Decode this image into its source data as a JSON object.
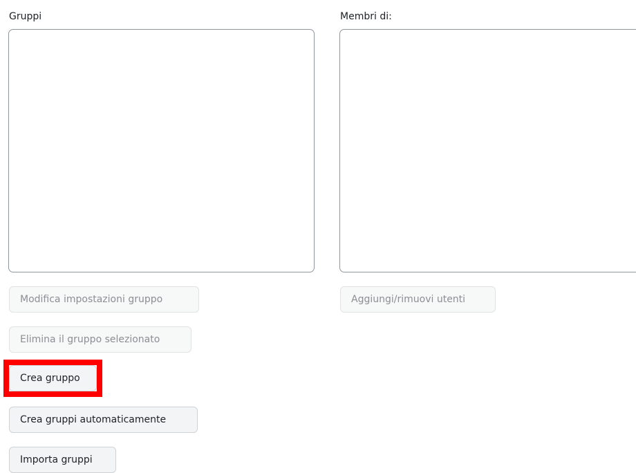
{
  "groups_panel": {
    "label": "Gruppi",
    "items": []
  },
  "members_panel": {
    "label": "Membri di:",
    "items": []
  },
  "buttons": {
    "edit_group_settings": "Modifica impostazioni gruppo",
    "delete_selected_group": "Elimina il gruppo selezionato",
    "create_group": "Crea gruppo",
    "auto_create_groups": "Crea gruppi automaticamente",
    "import_groups": "Importa gruppi",
    "add_remove_users": "Aggiungi/rimuovi utenti"
  },
  "highlight_color": "#ff0000"
}
